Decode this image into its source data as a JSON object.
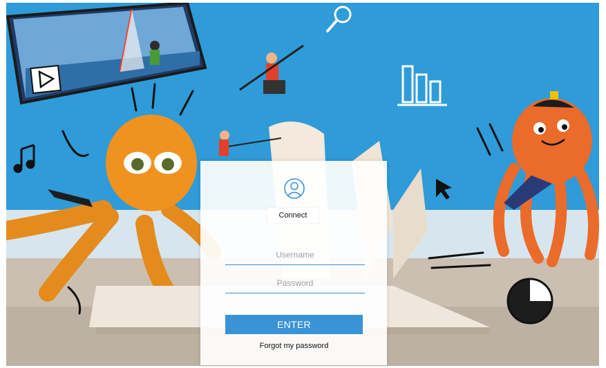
{
  "login": {
    "connect_label": "Connect",
    "username_placeholder": "Username",
    "password_placeholder": "Password",
    "enter_label": "ENTER",
    "forgot_label": "Forgot my password"
  },
  "icons": {
    "user": "user-circle-icon",
    "play": "play-icon",
    "search": "magnifier-icon",
    "bar_chart": "bar-chart-icon",
    "pie_chart": "pie-chart-icon",
    "cursor": "cursor-arrow-icon",
    "music": "music-note-icon"
  },
  "colors": {
    "sky": "#2f9bd8",
    "octopus": "#f08a1c",
    "accent": "#3a93d6",
    "field_line": "#3d8ecf"
  }
}
